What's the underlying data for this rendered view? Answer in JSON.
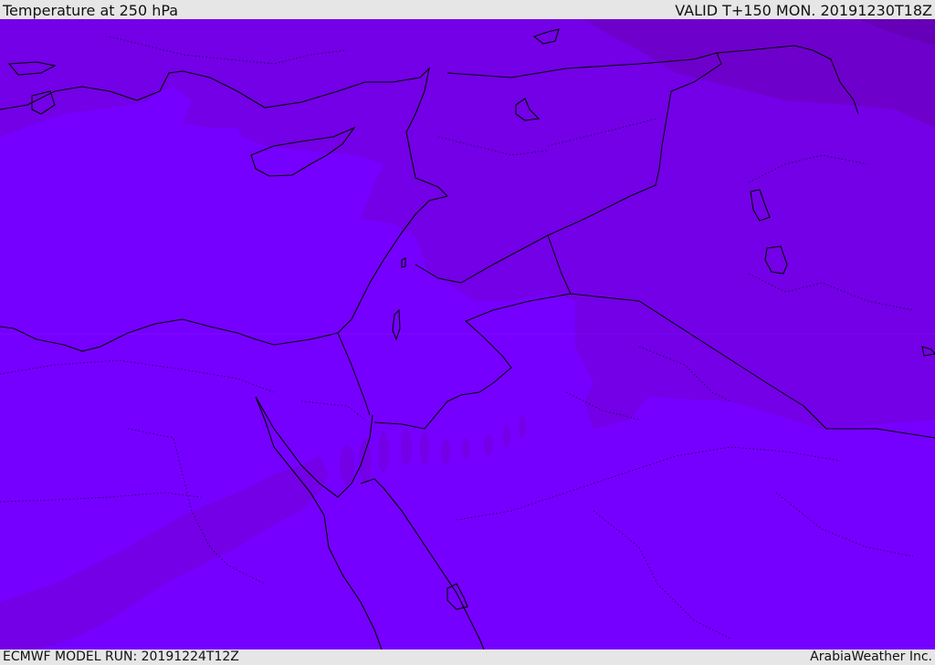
{
  "header": {
    "title": "Temperature at 250 hPa",
    "valid_time": "VALID T+150 MON. 20191230T18Z"
  },
  "footer": {
    "model_run": "ECMWF MODEL RUN: 20191224T12Z",
    "credit": "ArabiaWeather Inc."
  },
  "colors": {
    "background_field": "#7600ff",
    "colder_band": "#7300e6",
    "coldest_band": "#6e00cc",
    "coast_border": "#000000",
    "frame": "#e6e6e6"
  }
}
